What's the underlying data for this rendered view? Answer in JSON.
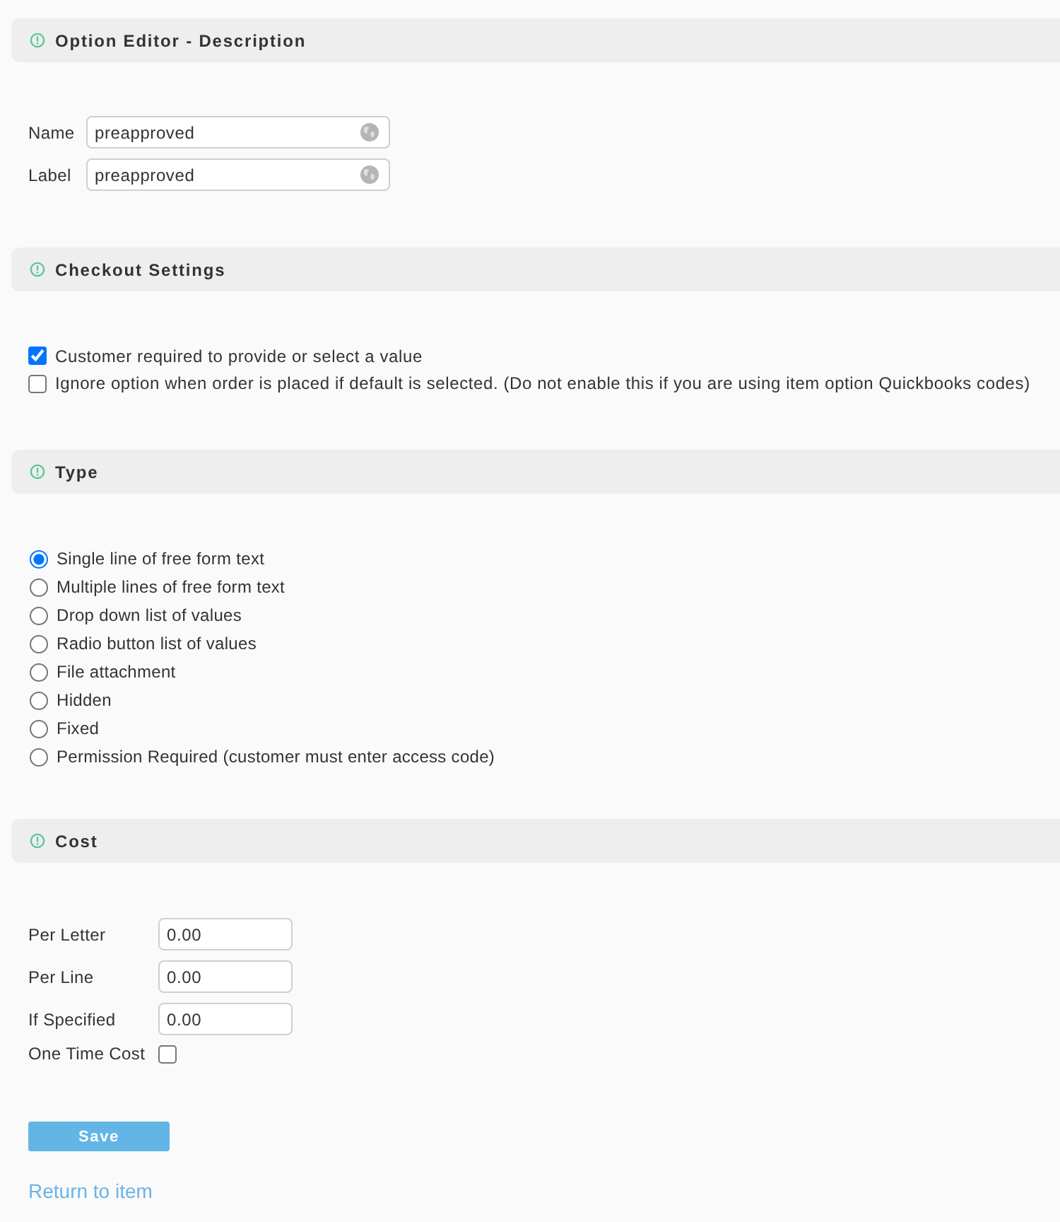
{
  "description": {
    "title": "Option Editor - Description",
    "fields": [
      {
        "label": "Name",
        "value": "preapproved"
      },
      {
        "label": "Label",
        "value": "preapproved"
      }
    ]
  },
  "checkout": {
    "title": "Checkout Settings",
    "options": [
      {
        "label": "Customer required to provide or select a value",
        "checked": true
      },
      {
        "label": "Ignore option when order is placed if default is selected. (Do not enable this if you are using item option Quickbooks codes)",
        "checked": false
      }
    ]
  },
  "type": {
    "title": "Type",
    "options": [
      {
        "label": "Single line of free form text",
        "selected": true
      },
      {
        "label": "Multiple lines of free form text",
        "selected": false
      },
      {
        "label": "Drop down list of values",
        "selected": false
      },
      {
        "label": "Radio button list of values",
        "selected": false
      },
      {
        "label": "File attachment",
        "selected": false
      },
      {
        "label": "Hidden",
        "selected": false
      },
      {
        "label": "Fixed",
        "selected": false
      },
      {
        "label": "Permission Required (customer must enter access code)",
        "selected": false
      }
    ]
  },
  "cost": {
    "title": "Cost",
    "fields": [
      {
        "label": "Per Letter",
        "value": "0.00"
      },
      {
        "label": "Per Line",
        "value": "0.00"
      },
      {
        "label": "If Specified",
        "value": "0.00"
      }
    ],
    "one_time": {
      "label": "One Time Cost",
      "checked": false
    }
  },
  "save_button": "Save",
  "return_link": "Return to item"
}
